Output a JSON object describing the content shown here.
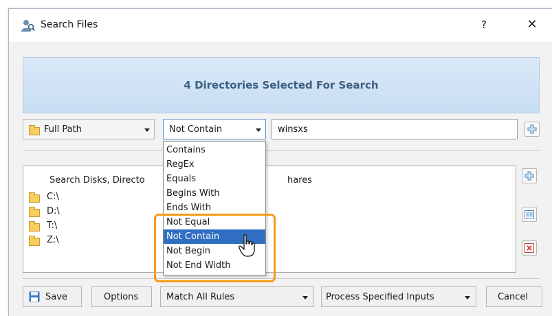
{
  "window": {
    "title": "Search Files",
    "help_label": "?",
    "close_label": "✕"
  },
  "banner": {
    "text": "4 Directories Selected For Search"
  },
  "filter": {
    "field_combo": "Full Path",
    "operator_combo": "Not Contain",
    "search_value": "winsxs"
  },
  "operator_options": [
    {
      "label": "Contains"
    },
    {
      "label": "RegEx"
    },
    {
      "label": "Equals"
    },
    {
      "label": "Begins With"
    },
    {
      "label": "Ends With"
    },
    {
      "label": "Not Equal"
    },
    {
      "label": "Not Contain"
    },
    {
      "label": "Not Begin"
    },
    {
      "label": "Not End Width"
    }
  ],
  "selected_option": "Not Contain",
  "list": {
    "header_left": "Search Disks, Directo",
    "header_right": "hares",
    "items": [
      {
        "label": "C:\\"
      },
      {
        "label": "D:\\"
      },
      {
        "label": "T:\\"
      },
      {
        "label": "Z:\\"
      }
    ]
  },
  "bottom": {
    "save": "Save",
    "options": "Options",
    "match_rules": "Match All Rules",
    "process_inputs": "Process Specified Inputs",
    "cancel": "Cancel"
  },
  "icons": {
    "app": "user-search-icon",
    "folder": "folder-icon",
    "add": "plus-icon",
    "edit": "edit-icon",
    "remove": "remove-icon",
    "save": "floppy-icon",
    "cursor": "hand-pointer-icon"
  },
  "colors": {
    "banner_text": "#3e5f82",
    "selection": "#2f6ec0",
    "highlight": "#f39c18"
  }
}
